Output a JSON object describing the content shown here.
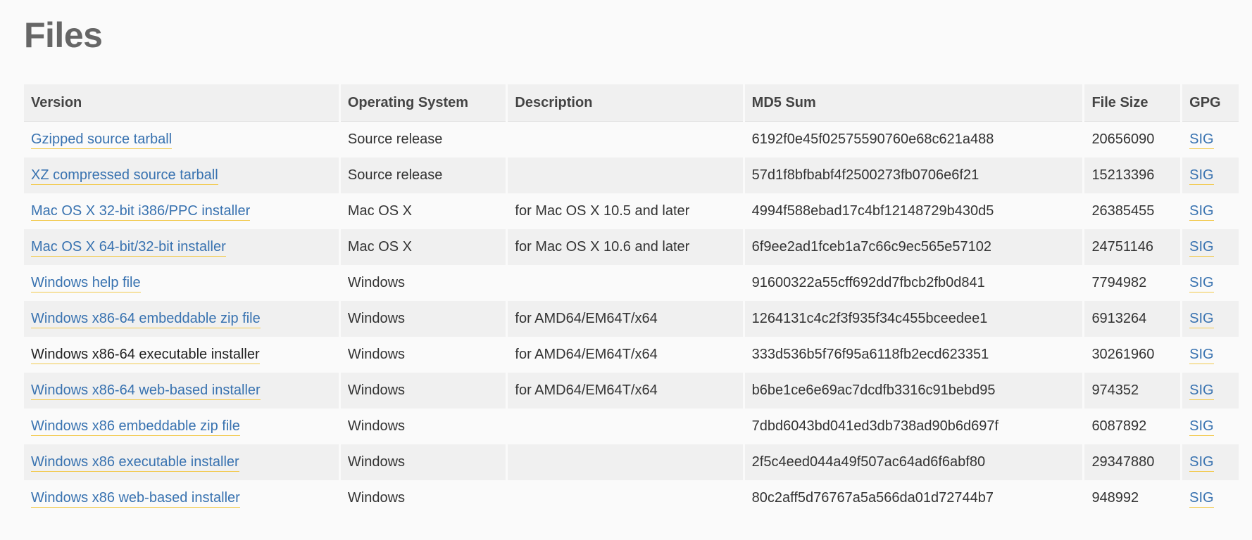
{
  "page": {
    "title": "Files"
  },
  "table": {
    "headers": [
      "Version",
      "Operating System",
      "Description",
      "MD5 Sum",
      "File Size",
      "GPG"
    ],
    "rows": [
      {
        "version": "Gzipped source tarball",
        "os": "Source release",
        "description": "",
        "md5": "6192f0e45f02575590760e68c621a488",
        "size": "20656090",
        "gpg": "SIG"
      },
      {
        "version": "XZ compressed source tarball",
        "os": "Source release",
        "description": "",
        "md5": "57d1f8bfbabf4f2500273fb0706e6f21",
        "size": "15213396",
        "gpg": "SIG"
      },
      {
        "version": "Mac OS X 32-bit i386/PPC installer",
        "os": "Mac OS X",
        "description": "for Mac OS X 10.5 and later",
        "md5": "4994f588ebad17c4bf12148729b430d5",
        "size": "26385455",
        "gpg": "SIG"
      },
      {
        "version": "Mac OS X 64-bit/32-bit installer",
        "os": "Mac OS X",
        "description": "for Mac OS X 10.6 and later",
        "md5": "6f9ee2ad1fceb1a7c66c9ec565e57102",
        "size": "24751146",
        "gpg": "SIG"
      },
      {
        "version": "Windows help file",
        "os": "Windows",
        "description": "",
        "md5": "91600322a55cff692dd7fbcb2fb0d841",
        "size": "7794982",
        "gpg": "SIG"
      },
      {
        "version": "Windows x86-64 embeddable zip file",
        "os": "Windows",
        "description": "for AMD64/EM64T/x64",
        "md5": "1264131c4c2f3f935f34c455bceedee1",
        "size": "6913264",
        "gpg": "SIG"
      },
      {
        "version": "Windows x86-64 executable installer",
        "os": "Windows",
        "description": "for AMD64/EM64T/x64",
        "md5": "333d536b5f76f95a6118fb2ecd623351",
        "size": "30261960",
        "gpg": "SIG",
        "visited": true
      },
      {
        "version": "Windows x86-64 web-based installer",
        "os": "Windows",
        "description": "for AMD64/EM64T/x64",
        "md5": "b6be1ce6e69ac7dcdfb3316c91bebd95",
        "size": "974352",
        "gpg": "SIG"
      },
      {
        "version": "Windows x86 embeddable zip file",
        "os": "Windows",
        "description": "",
        "md5": "7dbd6043bd041ed3db738ad90b6d697f",
        "size": "6087892",
        "gpg": "SIG"
      },
      {
        "version": "Windows x86 executable installer",
        "os": "Windows",
        "description": "",
        "md5": "2f5c4eed044a49f507ac64ad6f6abf80",
        "size": "29347880",
        "gpg": "SIG"
      },
      {
        "version": "Windows x86 web-based installer",
        "os": "Windows",
        "description": "",
        "md5": "80c2aff5d76767a5a566da01d72744b7",
        "size": "948992",
        "gpg": "SIG"
      }
    ]
  },
  "colors": {
    "link": "#3872b0",
    "link_underline": "#f2c94c",
    "heading": "#666666",
    "header_bg": "#f0f0f0",
    "row_alt_bg": "#f0f0f0",
    "page_bg": "#fafafa"
  }
}
